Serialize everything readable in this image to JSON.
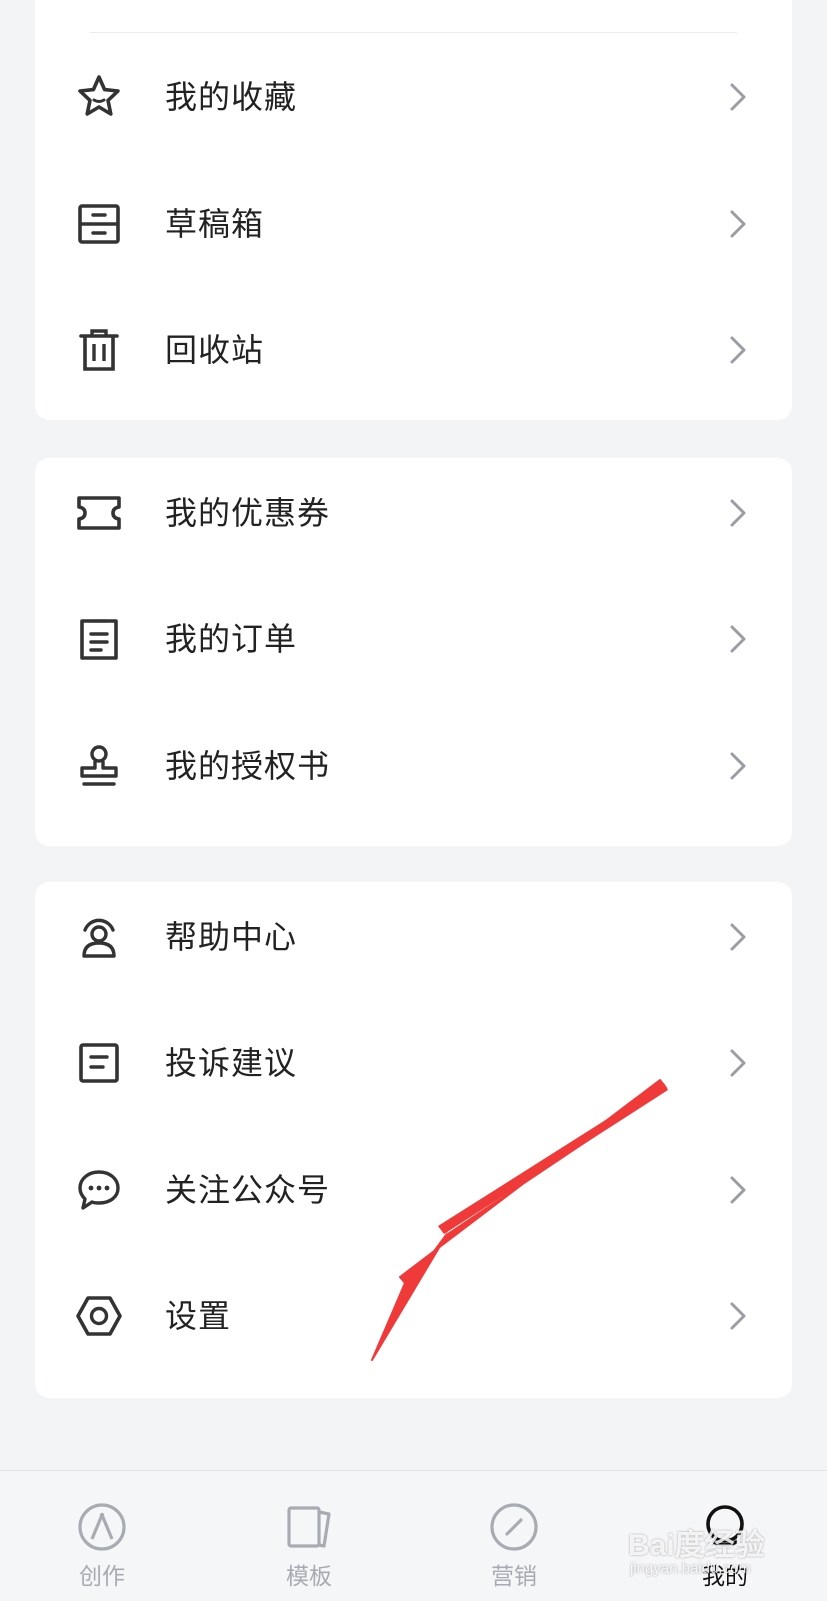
{
  "menu_groups": [
    {
      "items": [
        {
          "label": "我的收藏",
          "icon": "star-icon"
        },
        {
          "label": "草稿箱",
          "icon": "drawer-icon"
        },
        {
          "label": "回收站",
          "icon": "trash-icon"
        }
      ]
    },
    {
      "items": [
        {
          "label": "我的优惠券",
          "icon": "ticket-icon"
        },
        {
          "label": "我的订单",
          "icon": "order-list-icon"
        },
        {
          "label": "我的授权书",
          "icon": "stamp-icon"
        }
      ]
    },
    {
      "items": [
        {
          "label": "帮助中心",
          "icon": "support-agent-icon"
        },
        {
          "label": "投诉建议",
          "icon": "feedback-icon"
        },
        {
          "label": "关注公众号",
          "icon": "chat-bubble-icon"
        },
        {
          "label": "设置",
          "icon": "settings-hexagon-icon"
        }
      ]
    }
  ],
  "tabbar": {
    "tabs": [
      {
        "label": "创作",
        "icon": "compass-pen-icon",
        "active": false
      },
      {
        "label": "模板",
        "icon": "template-icon",
        "active": false
      },
      {
        "label": "营销",
        "icon": "marketing-compass-icon",
        "active": false
      },
      {
        "label": "我的",
        "icon": "profile-icon",
        "active": true
      }
    ]
  },
  "colors": {
    "page_bg": "#f3f4f6",
    "card_bg": "#ffffff",
    "icon_stroke": "#333333",
    "chevron": "#9a9da3",
    "tab_inactive": "#a8abb1",
    "tab_active": "#111111",
    "annotation_arrow": "#f03a3a"
  },
  "watermark": {
    "main": "Bai度经验",
    "sub": "jingyan.baidu.com"
  }
}
